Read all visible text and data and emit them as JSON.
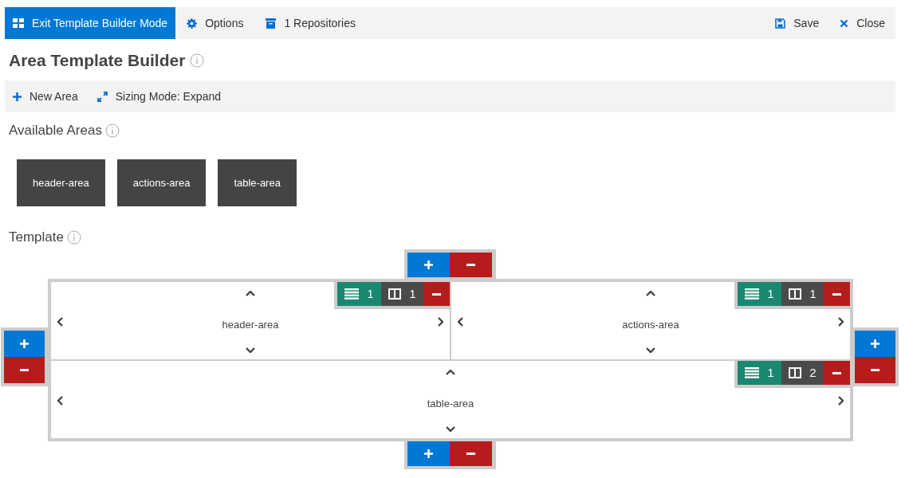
{
  "toolbar": {
    "left": [
      {
        "label": "Exit Template Builder Mode",
        "kind": "primary"
      },
      {
        "label": "Options",
        "kind": "plain"
      },
      {
        "label": "1 Repositories",
        "kind": "plain"
      }
    ],
    "right": [
      {
        "label": "Save"
      },
      {
        "label": "Close"
      }
    ]
  },
  "title": "Area Template Builder",
  "area_toolbar": [
    {
      "label": "New Area"
    },
    {
      "label": "Sizing Mode: Expand"
    }
  ],
  "available_areas": {
    "heading": "Available Areas",
    "areas": [
      "header-area",
      "actions-area",
      "table-area"
    ]
  },
  "template": {
    "heading": "Template",
    "cells": [
      {
        "name": "header-area",
        "row_span": "1",
        "column_span": "1"
      },
      {
        "name": "actions-area",
        "row_span": "1",
        "column_span": "1"
      },
      {
        "name": "table-area",
        "row_span": "1",
        "column_span": "2"
      }
    ]
  }
}
